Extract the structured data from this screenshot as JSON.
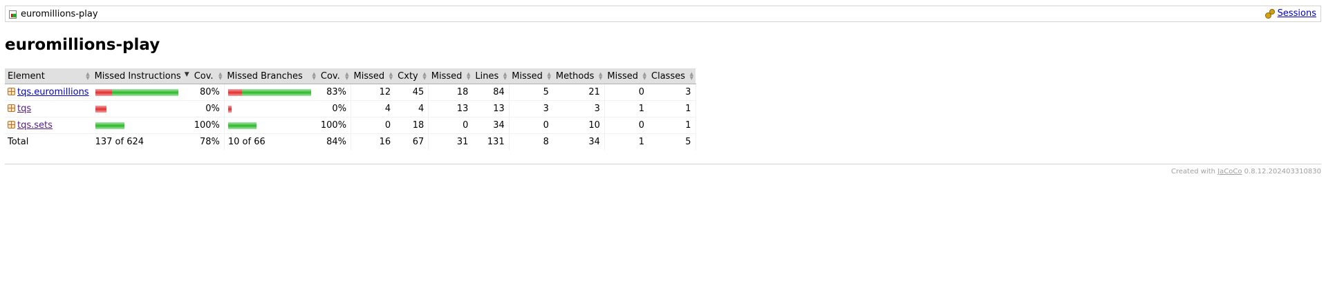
{
  "breadcrumb": {
    "title": "euromillions-play",
    "sessions_label": "Sessions"
  },
  "page": {
    "title": "euromillions-play"
  },
  "table": {
    "headers": [
      "Element",
      "Missed Instructions",
      "Cov.",
      "Missed Branches",
      "Cov.",
      "Missed",
      "Cxty",
      "Missed",
      "Lines",
      "Missed",
      "Methods",
      "Missed",
      "Classes"
    ],
    "rows": [
      {
        "element": "tqs.euromillions",
        "instr_missed_frac": 0.2,
        "instr_covered_frac": 0.8,
        "instr_cov": "80%",
        "branch_missed_frac": 0.17,
        "branch_covered_frac": 0.83,
        "branch_cov": "83%",
        "cxty_missed": "12",
        "cxty": "45",
        "lines_missed": "18",
        "lines": "84",
        "methods_missed": "5",
        "methods": "21",
        "classes_missed": "0",
        "classes": "3"
      },
      {
        "element": "tqs",
        "instr_missed_frac": 0.13,
        "instr_covered_frac": 0.0,
        "instr_cov": "0%",
        "branch_missed_frac": 0.04,
        "branch_covered_frac": 0.0,
        "branch_cov": "0%",
        "cxty_missed": "4",
        "cxty": "4",
        "lines_missed": "13",
        "lines": "13",
        "methods_missed": "3",
        "methods": "3",
        "classes_missed": "1",
        "classes": "1"
      },
      {
        "element": "tqs.sets",
        "instr_missed_frac": 0.0,
        "instr_covered_frac": 0.35,
        "instr_cov": "100%",
        "branch_missed_frac": 0.0,
        "branch_covered_frac": 0.34,
        "branch_cov": "100%",
        "cxty_missed": "0",
        "cxty": "18",
        "lines_missed": "0",
        "lines": "34",
        "methods_missed": "0",
        "methods": "10",
        "classes_missed": "0",
        "classes": "1"
      }
    ],
    "total": {
      "label": "Total",
      "instr": "137 of 624",
      "instr_cov": "78%",
      "branch": "10 of 66",
      "branch_cov": "84%",
      "cxty_missed": "16",
      "cxty": "67",
      "lines_missed": "31",
      "lines": "131",
      "methods_missed": "8",
      "methods": "34",
      "classes_missed": "1",
      "classes": "5"
    }
  },
  "footer": {
    "prefix": "Created with",
    "tool": "JaCoCo",
    "version": "0.8.12.202403310830"
  }
}
